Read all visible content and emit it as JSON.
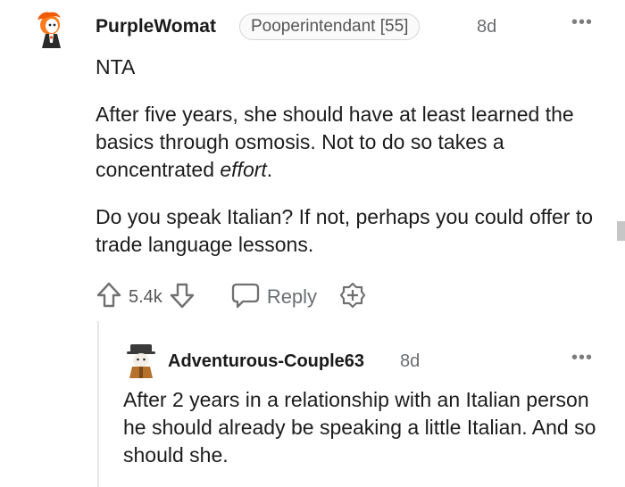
{
  "comment": {
    "username": "PurpleWomat",
    "flair": "Pooperintendant [55]",
    "age": "8d",
    "menu_label": "•••",
    "paragraphs": [
      "NTA",
      "After five years, she should have at least learned the basics through osmosis. Not to do so takes a concentrated",
      "Do you speak Italian? If not, perhaps you could offer to trade language lessons."
    ],
    "emphasis": "effort",
    "emphasis_suffix": ".",
    "score": "5.4k",
    "reply_label": "Reply",
    "icons": [
      "avatar",
      "upvote-icon",
      "downvote-icon",
      "comment-bubble-icon",
      "award-plus-icon",
      "more-options-icon"
    ]
  },
  "reply": {
    "username": "Adventurous-Couple63",
    "age": "8d",
    "menu_label": "•••",
    "text": "After 2 years in a relationship with an Italian person he should already be speaking a little Italian. And so should she."
  }
}
